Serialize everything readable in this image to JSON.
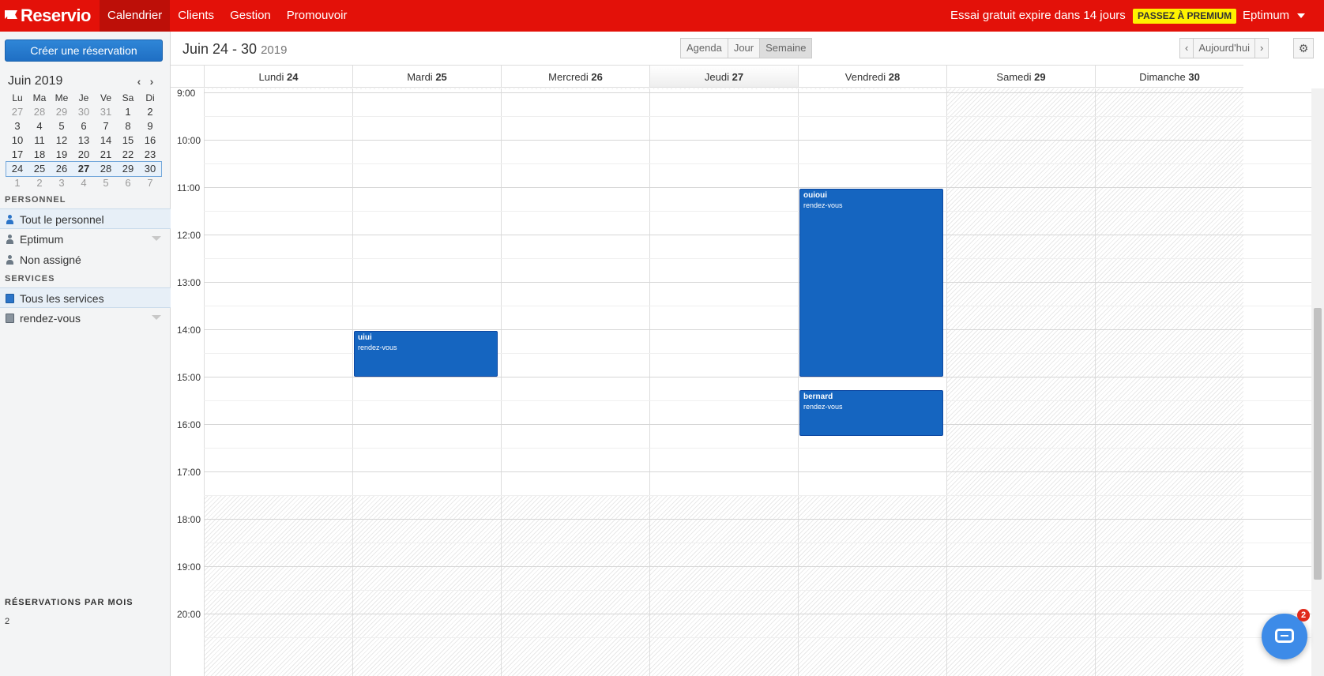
{
  "topbar": {
    "logo": "Reservio",
    "nav": [
      {
        "label": "Calendrier",
        "active": true
      },
      {
        "label": "Clients",
        "active": false
      },
      {
        "label": "Gestion",
        "active": false
      },
      {
        "label": "Promouvoir",
        "active": false
      }
    ],
    "trial_text": "Essai gratuit expire dans 14 jours",
    "premium_label": "PASSEZ À PREMIUM",
    "user_name": "Eptimum"
  },
  "sidebar": {
    "create_button": "Créer une réservation",
    "mini_calendar": {
      "month": "Juin 2019",
      "weekdays": [
        "Lu",
        "Ma",
        "Me",
        "Je",
        "Ve",
        "Sa",
        "Di"
      ],
      "weeks": [
        [
          "27",
          "28",
          "29",
          "30",
          "31",
          "1",
          "2"
        ],
        [
          "3",
          "4",
          "5",
          "6",
          "7",
          "8",
          "9"
        ],
        [
          "10",
          "11",
          "12",
          "13",
          "14",
          "15",
          "16"
        ],
        [
          "17",
          "18",
          "19",
          "20",
          "21",
          "22",
          "23"
        ],
        [
          "24",
          "25",
          "26",
          "27",
          "28",
          "29",
          "30"
        ],
        [
          "1",
          "2",
          "3",
          "4",
          "5",
          "6",
          "7"
        ]
      ],
      "today": "27"
    },
    "personnel_title": "PERSONNEL",
    "personnel": [
      {
        "label": "Tout le personnel",
        "active": true
      },
      {
        "label": "Eptimum",
        "active": false
      },
      {
        "label": "Non assigné",
        "active": false
      }
    ],
    "services_title": "SERVICES",
    "services": [
      {
        "label": "Tous les services",
        "active": true
      },
      {
        "label": "rendez-vous",
        "active": false
      }
    ],
    "reservations_title": "RÉSERVATIONS PAR MOIS",
    "reservations_count": "2"
  },
  "header": {
    "week_range": "Juin 24 - 30",
    "year": "2019",
    "views": [
      "Agenda",
      "Jour",
      "Semaine"
    ],
    "active_view": "Semaine",
    "today_label": "Aujourd'hui"
  },
  "calendar": {
    "days": [
      {
        "name": "Lundi",
        "num": "24"
      },
      {
        "name": "Mardi",
        "num": "25"
      },
      {
        "name": "Mercredi",
        "num": "26"
      },
      {
        "name": "Jeudi",
        "num": "27",
        "today": true
      },
      {
        "name": "Vendredi",
        "num": "28"
      },
      {
        "name": "Samedi",
        "num": "29"
      },
      {
        "name": "Dimanche",
        "num": "30"
      }
    ],
    "hours": [
      "9:00",
      "10:00",
      "11:00",
      "12:00",
      "13:00",
      "14:00",
      "15:00",
      "16:00",
      "17:00",
      "18:00",
      "19:00",
      "20:00"
    ],
    "first_hour": 9,
    "open_from": 9,
    "open_until": 17.5,
    "closed_days": [
      5,
      6
    ],
    "events": [
      {
        "day": 1,
        "start": 14.0,
        "end": 15.0,
        "name": "uiui",
        "service": "rendez-vous"
      },
      {
        "day": 4,
        "start": 11.0,
        "end": 15.0,
        "name": "ouioui",
        "service": "rendez-vous"
      },
      {
        "day": 4,
        "start": 15.25,
        "end": 16.25,
        "name": "bernard",
        "service": "rendez-vous"
      }
    ]
  },
  "chat": {
    "badge": "2"
  },
  "colors": {
    "brand": "#e31109",
    "event": "#1565c0",
    "premium": "#fff200"
  }
}
